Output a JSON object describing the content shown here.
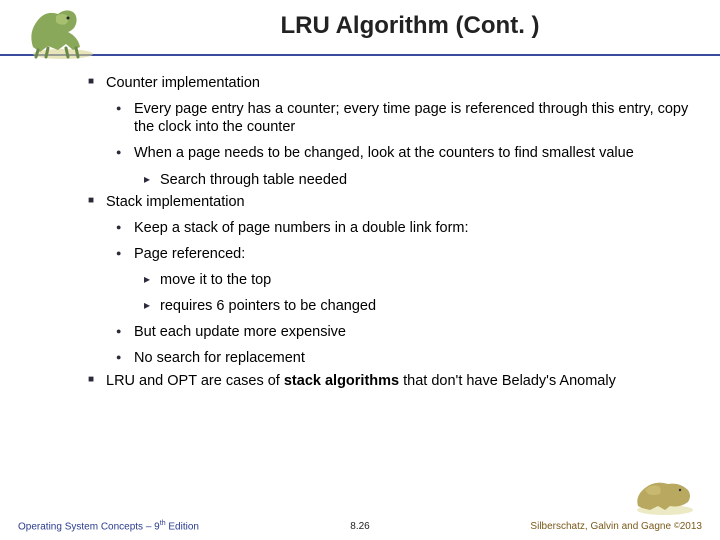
{
  "title": "LRU Algorithm (Cont. )",
  "bullets": {
    "b1": "Counter implementation",
    "b1a": "Every page entry has a counter; every time page is referenced through this entry, copy the clock into the counter",
    "b1b": "When a page needs to be changed, look at the counters to find smallest value",
    "b1b1": "Search through table needed",
    "b2": "Stack implementation",
    "b2a": "Keep a stack of page numbers in a double link form:",
    "b2b": "Page referenced:",
    "b2b1": "move it to the top",
    "b2b2": "requires 6 pointers to be changed",
    "b2c": "But each update more expensive",
    "b2d": "No search for replacement",
    "b3_pre": "LRU and OPT are cases of ",
    "b3_bold": "stack algorithms",
    "b3_post": " that don't have Belady's Anomaly"
  },
  "footer": {
    "left_pre": "Operating System Concepts – 9",
    "left_sup": "th",
    "left_post": " Edition",
    "mid": "8.26",
    "right_pre": "Silberschatz, Galvin and Gagne ",
    "right_copy": "©",
    "right_post": "2013"
  }
}
